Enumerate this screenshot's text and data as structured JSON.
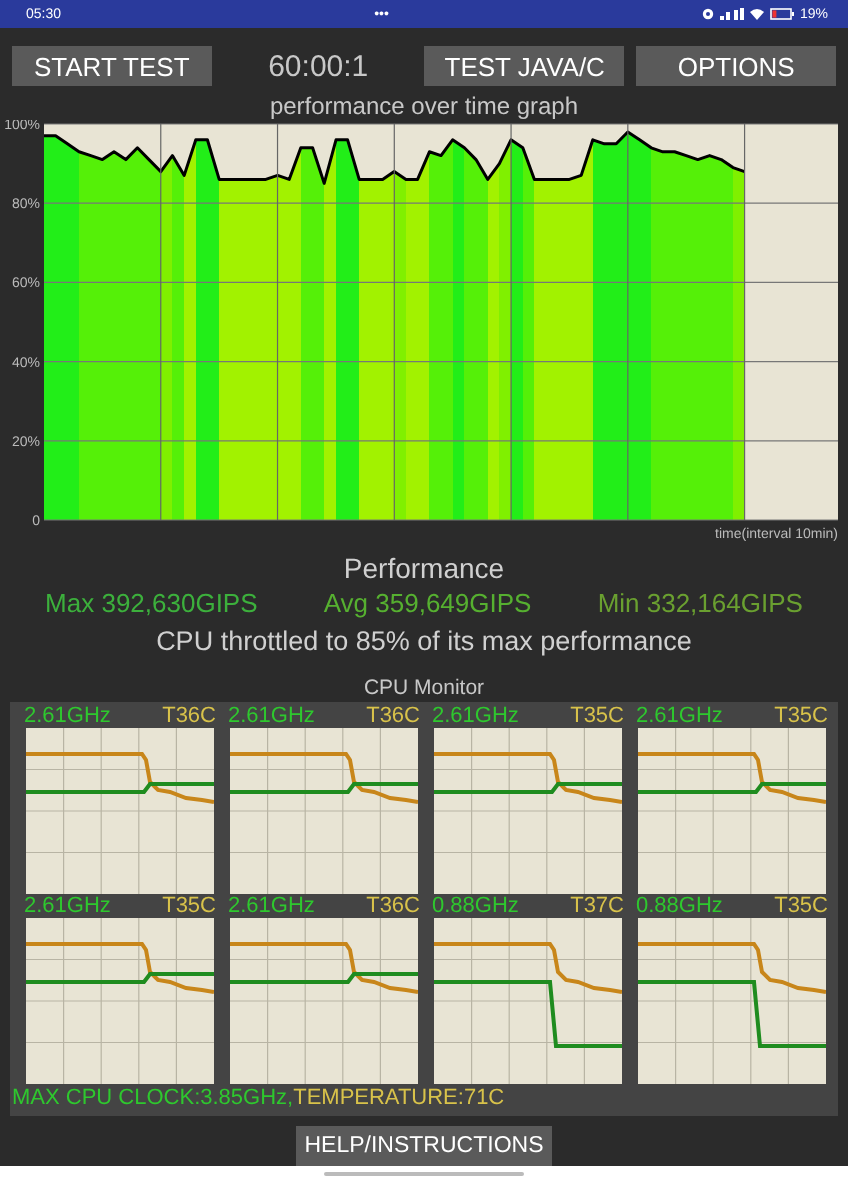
{
  "status_bar": {
    "time": "05:30",
    "dots": "•••",
    "battery": "19%"
  },
  "toolbar": {
    "buttons": [
      "START TEST",
      "TEST JAVA/C",
      "OPTIONS"
    ],
    "timer": "60:00:1"
  },
  "performance_graph": {
    "title": "performance over time graph",
    "chart_data": {
      "type": "area",
      "grid": true,
      "xlabel": "time(interval 10min)",
      "ylim": [
        0,
        100
      ],
      "yticks": [
        {
          "value": 0,
          "label": "0"
        },
        {
          "value": 20,
          "label": "20%"
        },
        {
          "value": 40,
          "label": "40%"
        },
        {
          "value": 60,
          "label": "60%"
        },
        {
          "value": 80,
          "label": "80%"
        },
        {
          "value": 100,
          "label": "100%"
        }
      ],
      "categories": [
        null,
        null,
        null,
        null,
        null,
        null,
        null,
        null,
        null,
        null,
        null,
        null,
        null,
        null,
        null,
        null,
        null,
        null,
        null,
        null,
        null,
        null,
        null,
        null,
        null,
        null,
        null,
        null,
        null,
        null,
        null,
        null,
        null,
        null,
        null,
        null,
        null,
        null,
        null,
        null,
        null,
        null,
        null,
        null,
        null,
        null,
        null,
        null,
        null,
        null,
        null,
        null,
        null,
        null,
        null,
        null,
        null,
        null,
        null,
        null,
        null,
        null,
        null,
        null,
        null,
        null,
        null,
        null,
        null
      ],
      "series": [
        {
          "color": "#000000",
          "values": [
            97,
            97,
            95,
            93,
            92,
            91,
            93,
            91,
            94,
            91,
            88,
            92,
            87,
            96,
            96,
            86,
            86,
            86,
            86,
            86,
            87,
            86,
            94,
            94,
            85,
            96,
            96,
            86,
            86,
            86,
            88,
            86,
            86,
            93,
            92,
            96,
            94,
            91,
            86,
            90,
            96,
            94,
            86,
            86,
            86,
            86,
            87,
            96,
            95,
            95,
            98,
            96,
            94,
            93,
            93,
            92,
            91,
            92,
            91,
            89,
            88,
            null,
            null,
            null,
            null,
            null,
            null,
            null,
            null
          ]
        }
      ]
    }
  },
  "summary": {
    "title": "Performance",
    "stats": [
      {
        "text": "Max 392,630GIPS",
        "color": "#3cb03c"
      },
      {
        "text": "Avg 359,649GIPS",
        "color": "#56b030"
      },
      {
        "text": "Min 332,164GIPS",
        "color": "#6aa030"
      }
    ],
    "throttle": "CPU throttled to 85% of its max performance"
  },
  "cpu_monitor": {
    "title": "CPU Monitor",
    "cores": [
      {
        "clock": "2.61GHz",
        "temp": "T36C",
        "kind": "hold"
      },
      {
        "clock": "2.61GHz",
        "temp": "T36C",
        "kind": "hold"
      },
      {
        "clock": "2.61GHz",
        "temp": "T35C",
        "kind": "hold"
      },
      {
        "clock": "2.61GHz",
        "temp": "T35C",
        "kind": "hold"
      },
      {
        "clock": "2.61GHz",
        "temp": "T35C",
        "kind": "hold"
      },
      {
        "clock": "2.61GHz",
        "temp": "T36C",
        "kind": "hold"
      },
      {
        "clock": "0.88GHz",
        "temp": "T37C",
        "kind": "drop"
      },
      {
        "clock": "0.88GHz",
        "temp": "T35C",
        "kind": "drop"
      }
    ],
    "max_clock": "MAX CPU CLOCK:3.85GHz,",
    "max_temp": "TEMPERATURE:71C"
  },
  "help_button": "HELP/INSTRUCTIONS"
}
